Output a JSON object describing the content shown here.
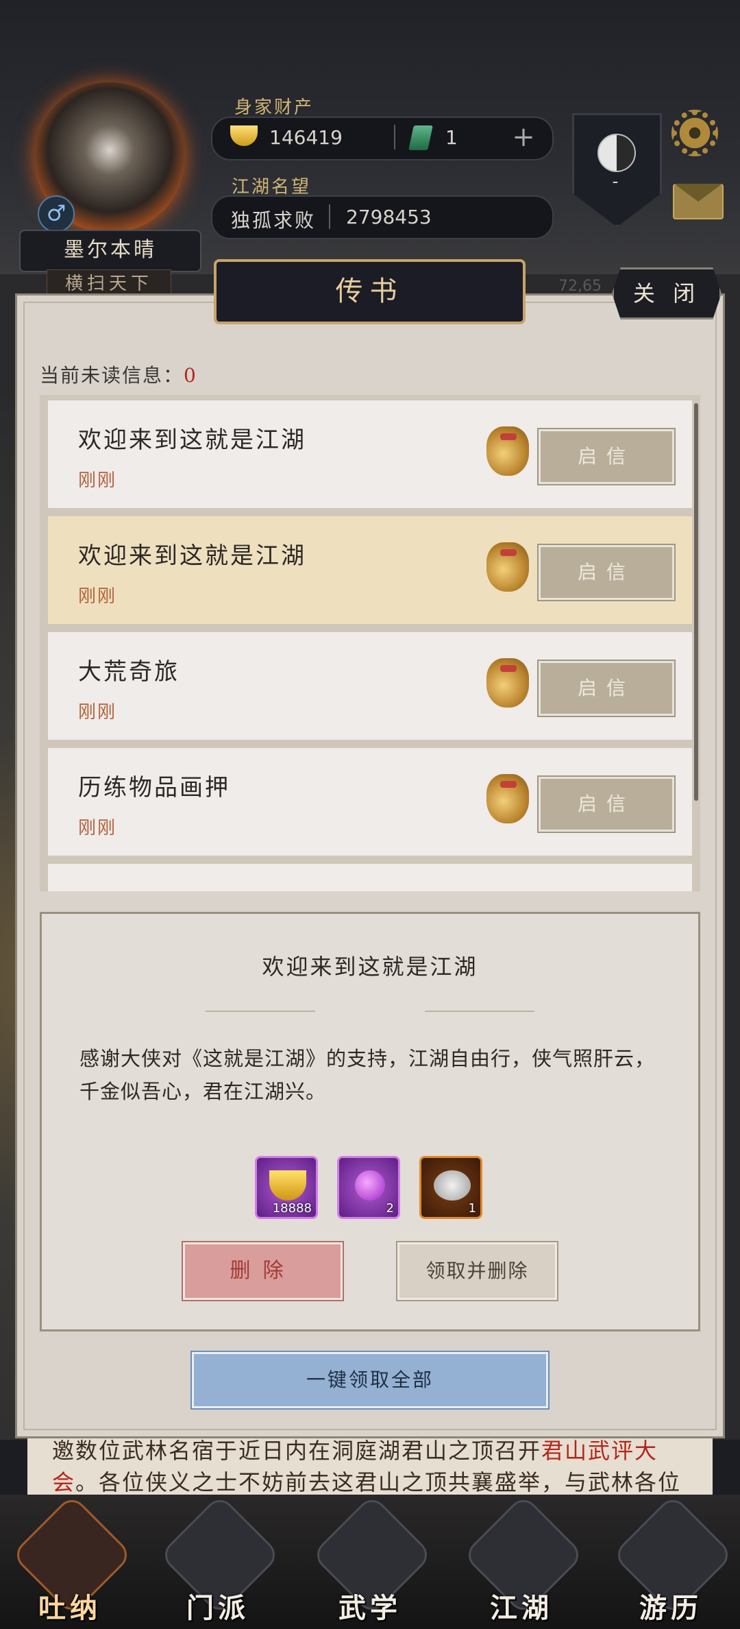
{
  "player": {
    "wealth_label": "身家财产",
    "gold": "146419",
    "jade": "1",
    "plus": "+",
    "fame_label": "江湖名望",
    "fame_title": "独孤求败",
    "fame_value": "2798453",
    "name": "墨尔本晴",
    "title": "横扫天下",
    "gender_symbol": "♂",
    "sect_value": "-"
  },
  "background": {
    "number": "72,65",
    "scroll_text_a": "邀数位武林名宿于近日内在洞庭湖君山之顶召开",
    "scroll_text_highlight": "君山武评大会",
    "scroll_text_b": "。各位侠义之士不妨前去这君山之顶共襄盛举，与武林各位同仁相互讨"
  },
  "dialog": {
    "title": "传书",
    "close_label": "关 闭",
    "unread_label": "当前未读信息：",
    "unread_count": "0"
  },
  "messages": [
    {
      "title": "欢迎来到这就是江湖",
      "time": "刚刚",
      "button": "启信",
      "selected": false
    },
    {
      "title": "欢迎来到这就是江湖",
      "time": "刚刚",
      "button": "启信",
      "selected": true
    },
    {
      "title": "大荒奇旅",
      "time": "刚刚",
      "button": "启信",
      "selected": false
    },
    {
      "title": "历练物品画押",
      "time": "刚刚",
      "button": "启信",
      "selected": false
    }
  ],
  "detail": {
    "title": "欢迎来到这就是江湖",
    "body": "感谢大侠对《这就是江湖》的支持，江湖自由行，侠气照肝云，千金似吾心，君在江湖兴。",
    "rewards": [
      {
        "icon": "gold-ingot-icon",
        "count": "18888",
        "rarity": "purple"
      },
      {
        "icon": "purple-orb-icon",
        "count": "2",
        "rarity": "purple"
      },
      {
        "icon": "silver-item-icon",
        "count": "1",
        "rarity": "orange"
      }
    ],
    "delete_label": "删除",
    "claim_delete_label": "领取并删除"
  },
  "claim_all_label": "一键领取全部",
  "nav": [
    {
      "label": "吐纳",
      "icon": "meditation-icon",
      "active": true
    },
    {
      "label": "门派",
      "icon": "sect-icon",
      "active": false
    },
    {
      "label": "武学",
      "icon": "martial-arts-icon",
      "active": false
    },
    {
      "label": "江湖",
      "icon": "jianghu-icon",
      "active": false
    },
    {
      "label": "游历",
      "icon": "travel-horse-icon",
      "active": false
    }
  ],
  "colors": {
    "accent_gold": "#c7a46a",
    "time_text": "#b5623a",
    "unread_count": "#b3261e",
    "delete_button": "#d99d9b",
    "claim_all_button": "#94b1d3"
  }
}
